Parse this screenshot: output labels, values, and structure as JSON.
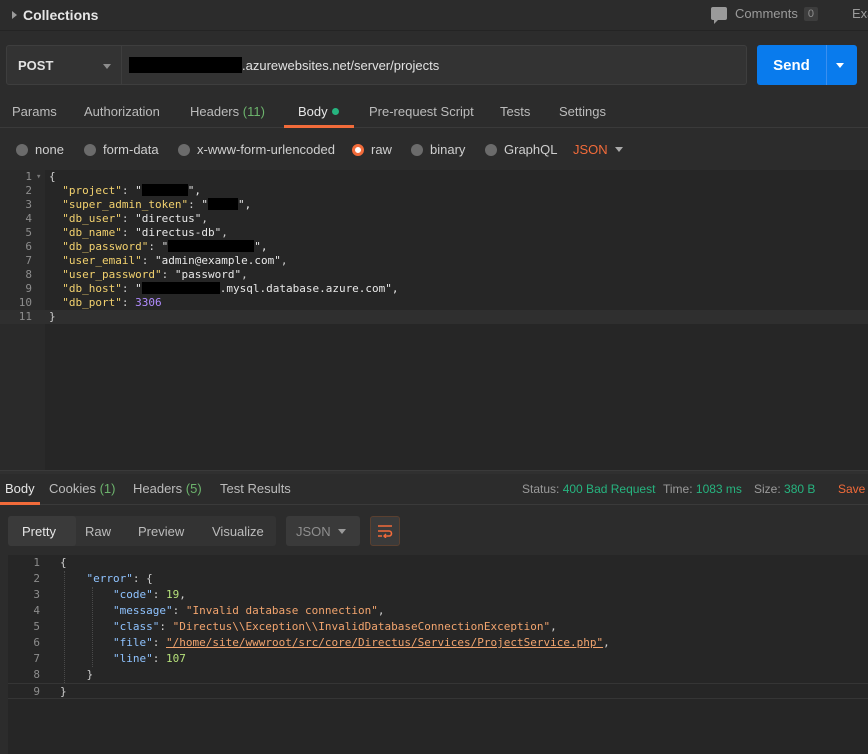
{
  "header": {
    "title": "Collections",
    "comments_label": "Comments",
    "comments_count": "0",
    "ex_label": "Exa"
  },
  "request": {
    "method": "POST",
    "url": ".azurewebsites.net/server/projects",
    "send_label": "Send"
  },
  "tabs": [
    {
      "label": "Params"
    },
    {
      "label": "Authorization"
    },
    {
      "label": "Headers",
      "count": "(11)"
    },
    {
      "label": "Body"
    },
    {
      "label": "Pre-request Script"
    },
    {
      "label": "Tests"
    },
    {
      "label": "Settings"
    }
  ],
  "body_options": {
    "items": [
      "none",
      "form-data",
      "x-www-form-urlencoded",
      "raw",
      "binary",
      "GraphQL"
    ],
    "selected": "raw",
    "format": "JSON"
  },
  "request_body": {
    "lines": [
      {
        "n": "1",
        "text": "{"
      },
      {
        "n": "2",
        "key": "\"project\"",
        "val": "\"",
        "tail": "\","
      },
      {
        "n": "3",
        "key": "\"super_admin_token\"",
        "val": "\"",
        "tail": "\","
      },
      {
        "n": "4",
        "key": "\"db_user\"",
        "val": "\"directus\"",
        "tail": ","
      },
      {
        "n": "5",
        "key": "\"db_name\"",
        "val": "\"directus-db\"",
        "tail": ","
      },
      {
        "n": "6",
        "key": "\"db_password\"",
        "val": "\"",
        "tail": "\","
      },
      {
        "n": "7",
        "key": "\"user_email\"",
        "val": "\"admin@example.com\"",
        "tail": ","
      },
      {
        "n": "8",
        "key": "\"user_password\"",
        "val": "\"password\"",
        "tail": ","
      },
      {
        "n": "9",
        "key": "\"db_host\"",
        "val": "\"",
        "tail": ".mysql.database.azure.com\","
      },
      {
        "n": "10",
        "key": "\"db_port\"",
        "num": "3306"
      },
      {
        "n": "11",
        "text": "}"
      }
    ]
  },
  "response": {
    "tabs": [
      {
        "label": "Body"
      },
      {
        "label": "Cookies",
        "count": "(1)"
      },
      {
        "label": "Headers",
        "count": "(5)"
      },
      {
        "label": "Test Results"
      }
    ],
    "status_label": "Status:",
    "status_value": "400 Bad Request",
    "time_label": "Time:",
    "time_value": "1083 ms",
    "size_label": "Size:",
    "size_value": "380 B",
    "save_label": "Save",
    "views": [
      "Pretty",
      "Raw",
      "Preview",
      "Visualize"
    ],
    "format": "JSON",
    "lines": [
      {
        "n": "1",
        "code": "{"
      },
      {
        "n": "2",
        "key": "\"error\"",
        "tail": ": {"
      },
      {
        "n": "3",
        "key": "\"code\"",
        "num": "19",
        "tail": ","
      },
      {
        "n": "4",
        "key": "\"message\"",
        "str": "\"Invalid database connection\"",
        "tail": ","
      },
      {
        "n": "5",
        "key": "\"class\"",
        "str": "\"Directus\\\\Exception\\\\InvalidDatabaseConnectionException\"",
        "tail": ","
      },
      {
        "n": "6",
        "key": "\"file\"",
        "str": "\"/home/site/wwwroot/src/core/Directus/Services/ProjectService.php\"",
        "tail": ","
      },
      {
        "n": "7",
        "key": "\"line\"",
        "num": "107"
      },
      {
        "n": "8",
        "code": "}"
      },
      {
        "n": "9",
        "code": "}"
      }
    ]
  }
}
